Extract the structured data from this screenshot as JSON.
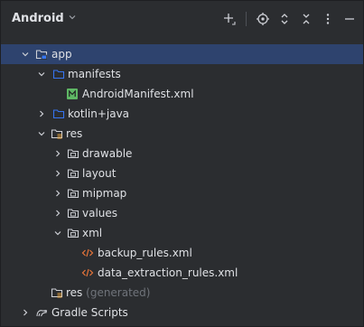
{
  "toolbar": {
    "view_label": "Android",
    "icons": [
      "add-icon",
      "locate-icon",
      "expand-collapse-icon",
      "close-icon",
      "more-icon",
      "minimize-icon"
    ]
  },
  "tree": {
    "app": "app",
    "manifests": "manifests",
    "android_manifest": "AndroidManifest.xml",
    "kotlin_java": "kotlin+java",
    "res": "res",
    "drawable": "drawable",
    "layout": "layout",
    "mipmap": "mipmap",
    "values": "values",
    "xml": "xml",
    "backup_rules": "backup_rules.xml",
    "data_extraction_rules": "data_extraction_rules.xml",
    "res_generated": "res",
    "res_generated_suffix": "(generated)",
    "gradle_scripts": "Gradle Scripts"
  },
  "colors": {
    "background": "#2b2d30",
    "selection": "#2e436e",
    "folder_blue": "#3574f0",
    "folder_gray": "#ced0d6",
    "manifest_green": "#5fb865",
    "xml_orange": "#e8753a",
    "dim_text": "#6f737a"
  }
}
